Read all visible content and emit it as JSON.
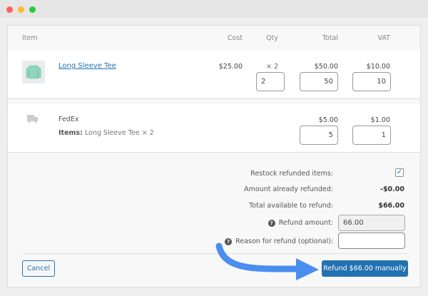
{
  "window": {
    "controls": [
      {
        "name": "close",
        "color": "#ff5f57"
      },
      {
        "name": "minimize",
        "color": "#febc2e"
      },
      {
        "name": "maximize",
        "color": "#28c840"
      }
    ]
  },
  "table": {
    "headers": {
      "item": "Item",
      "cost": "Cost",
      "qty": "Qty",
      "total": "Total",
      "vat": "VAT"
    },
    "product": {
      "name": "Long Sleeve Tee",
      "cost": "$25.00",
      "qty_label": "× 2",
      "total": "$50.00",
      "vat": "$10.00",
      "qty_input": "2",
      "total_input": "50",
      "vat_input": "10"
    },
    "shipping": {
      "name": "FedEx",
      "items_label": "Items:",
      "items_value": "Long Sleeve Tee × 2",
      "total": "$5.00",
      "vat": "$1.00",
      "total_input": "5",
      "vat_input": "1"
    }
  },
  "refund": {
    "restock_label": "Restock refunded items:",
    "restock_checked": true,
    "already_label": "Amount already refunded:",
    "already_value": "-$0.00",
    "available_label": "Total available to refund:",
    "available_value": "$66.00",
    "amount_label": "Refund amount:",
    "amount_value": "66.00",
    "reason_label": "Reason for refund (optional):",
    "reason_value": ""
  },
  "actions": {
    "cancel": "Cancel",
    "refund": "Refund $66.00 manually"
  },
  "colors": {
    "primary": "#2271b1",
    "arrow": "#4a8ef0",
    "link": "#2271b1"
  }
}
